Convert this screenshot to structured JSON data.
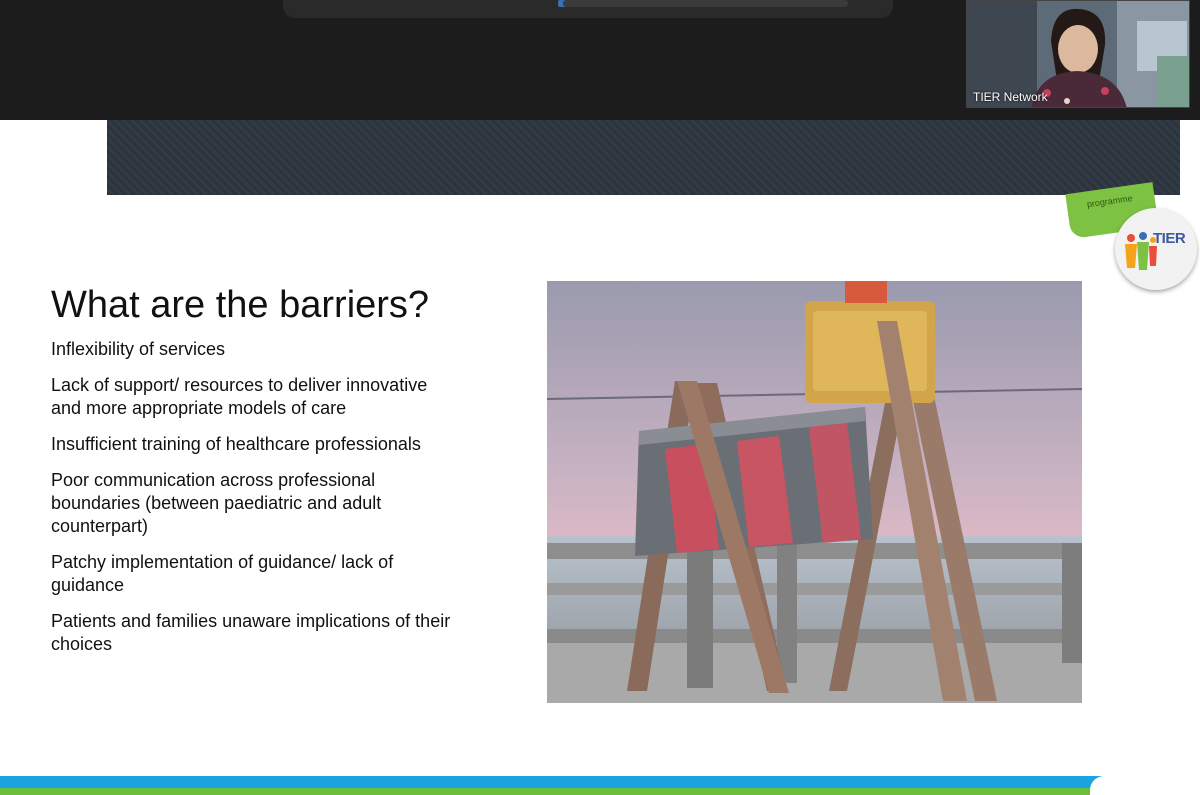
{
  "meeting": {
    "participant_name": "TIER Network"
  },
  "slide": {
    "badge_text": "programme",
    "logo_text": "TIER",
    "title": "What are the barriers?",
    "barriers": [
      "Inflexibility of services",
      "Lack of support/ resources to deliver innovative and more appropriate models of care",
      "Insufficient training of healthcare professionals",
      "Poor communication across professional boundaries (between paediatric and adult counterpart)",
      "Patchy implementation of guidance/ lack of guidance",
      "Patients and families unaware implications of their choices"
    ]
  },
  "colors": {
    "topbar": "#1c1c1c",
    "banner": "#2b333c",
    "accent_blue": "#1aa3e0",
    "accent_green": "#6cbf3a"
  }
}
